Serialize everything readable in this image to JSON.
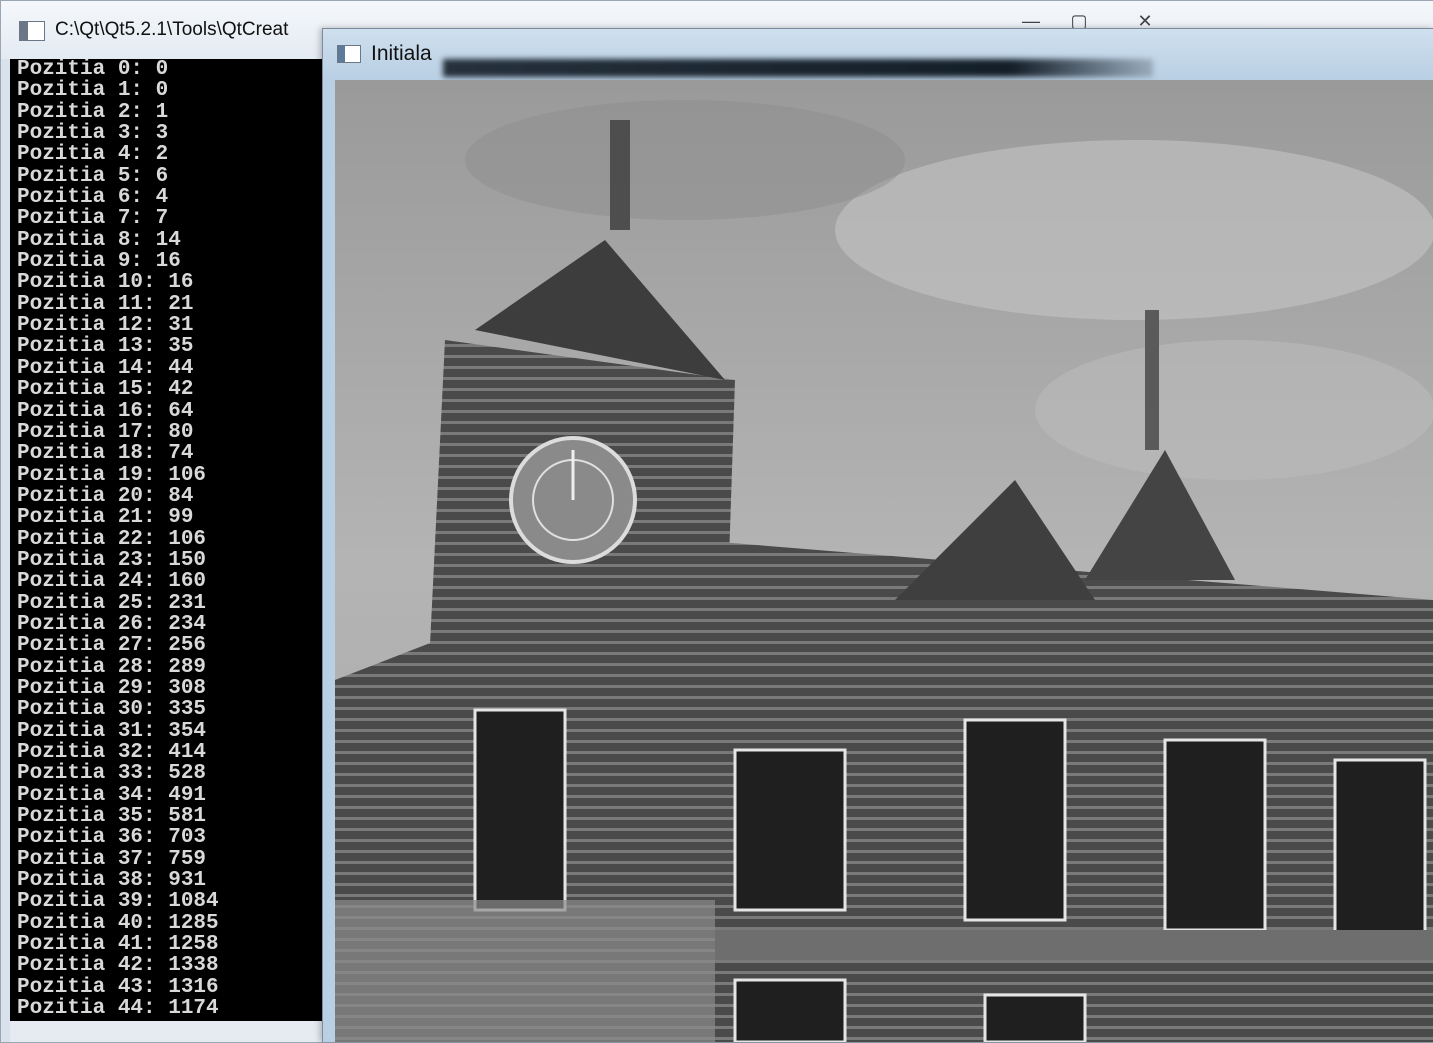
{
  "console": {
    "title": "C:\\Qt\\Qt5.2.1\\Tools\\QtCreat",
    "buttons": {
      "minimize": "—",
      "maximize": "▢",
      "close": "✕"
    },
    "lines": [
      "Pozitia 0: 0",
      "Pozitia 1: 0",
      "Pozitia 2: 1",
      "Pozitia 3: 3",
      "Pozitia 4: 2",
      "Pozitia 5: 6",
      "Pozitia 6: 4",
      "Pozitia 7: 7",
      "Pozitia 8: 14",
      "Pozitia 9: 16",
      "Pozitia 10: 16",
      "Pozitia 11: 21",
      "Pozitia 12: 31",
      "Pozitia 13: 35",
      "Pozitia 14: 44",
      "Pozitia 15: 42",
      "Pozitia 16: 64",
      "Pozitia 17: 80",
      "Pozitia 18: 74",
      "Pozitia 19: 106",
      "Pozitia 20: 84",
      "Pozitia 21: 99",
      "Pozitia 22: 106",
      "Pozitia 23: 150",
      "Pozitia 24: 160",
      "Pozitia 25: 231",
      "Pozitia 26: 234",
      "Pozitia 27: 256",
      "Pozitia 28: 289",
      "Pozitia 29: 308",
      "Pozitia 30: 335",
      "Pozitia 31: 354",
      "Pozitia 32: 414",
      "Pozitia 33: 528",
      "Pozitia 34: 491",
      "Pozitia 35: 581",
      "Pozitia 36: 703",
      "Pozitia 37: 759",
      "Pozitia 38: 931",
      "Pozitia 39: 1084",
      "Pozitia 40: 1285",
      "Pozitia 41: 1258",
      "Pozitia 42: 1338",
      "Pozitia 43: 1316",
      "Pozitia 44: 1174"
    ]
  },
  "image_window": {
    "title": "Initiala",
    "image_content": "grayscale photo of a historic brick building with clock tower"
  },
  "colors": {
    "console_bg": "#000000",
    "console_text": "#d9d9d9",
    "titlebar": "#dfe8f1"
  }
}
